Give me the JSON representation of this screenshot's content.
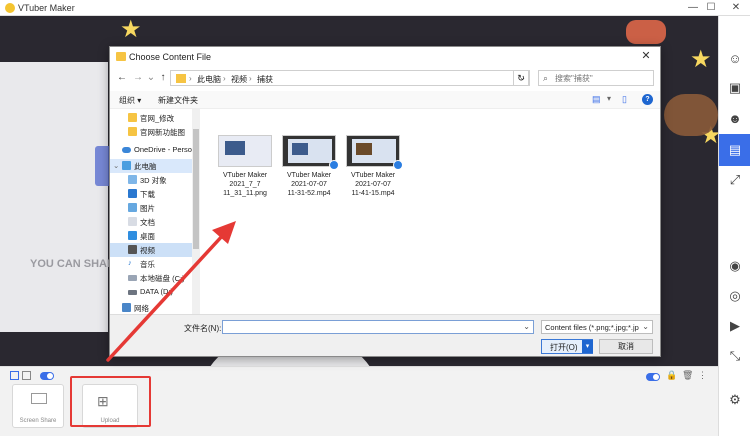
{
  "app": {
    "title": "VTuber Maker",
    "window_controls": [
      "—",
      "☐",
      "✕"
    ],
    "share_text": "YOU CAN SHARE",
    "bottom": {
      "tiles": [
        {
          "label": "Screen Share"
        },
        {
          "label": "Upload"
        }
      ]
    }
  },
  "dialog": {
    "title": "Choose Content File",
    "nav": {
      "back": "←",
      "forward": "→",
      "up": "↑",
      "recent": "⌄"
    },
    "breadcrumb": [
      "此电脑",
      "视频",
      "捕获"
    ],
    "search_placeholder": "搜索\"捕获\"",
    "toolbar": {
      "organize": "组织 ▾",
      "new_folder": "新建文件夹",
      "help": "?"
    },
    "tree": [
      {
        "label": "官网_修改",
        "icon": "folder-icon"
      },
      {
        "label": "官网新功能图",
        "icon": "folder-icon"
      },
      {
        "label": "OneDrive - Perso",
        "icon": "cloud-icon"
      },
      {
        "label": "此电脑",
        "icon": "computer-icon"
      },
      {
        "label": "3D 对象",
        "icon": "cube-icon"
      },
      {
        "label": "下载",
        "icon": "download-icon"
      },
      {
        "label": "图片",
        "icon": "picture-icon"
      },
      {
        "label": "文档",
        "icon": "document-icon"
      },
      {
        "label": "桌面",
        "icon": "desktop-icon"
      },
      {
        "label": "视频",
        "icon": "video-icon"
      },
      {
        "label": "音乐",
        "icon": "music-icon"
      },
      {
        "label": "本地磁盘 (C:)",
        "icon": "drive-icon"
      },
      {
        "label": "DATA (D:)",
        "icon": "drive-icon"
      },
      {
        "label": "网络",
        "icon": "network-icon"
      }
    ],
    "files": [
      {
        "name_lines": [
          "VTuber Maker",
          "2021_7_7",
          "11_31_11.png"
        ],
        "kind": "image"
      },
      {
        "name_lines": [
          "VTuber Maker",
          "2021-07-07",
          "11-31-52.mp4"
        ],
        "kind": "video"
      },
      {
        "name_lines": [
          "VTuber Maker",
          "2021-07-07",
          "11-41-15.mp4"
        ],
        "kind": "video"
      }
    ],
    "filename_label": "文件名(N):",
    "filename_value": "",
    "filter_value": "Content files (*.png;*.jpg;*.jp",
    "open_label": "打开(O)",
    "cancel_label": "取消"
  },
  "colors": {
    "accent": "#3a6ee8",
    "highlight": "#e53935",
    "stage_bg": "#2a2830"
  }
}
